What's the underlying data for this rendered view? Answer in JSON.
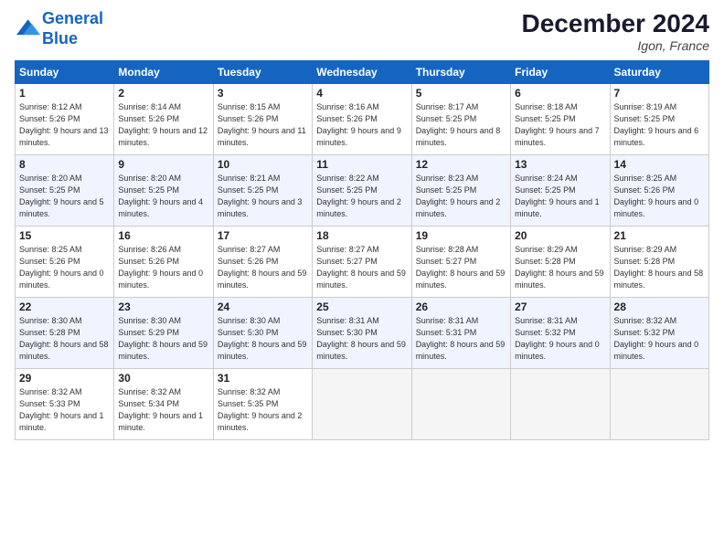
{
  "header": {
    "logo_line1": "General",
    "logo_line2": "Blue",
    "month": "December 2024",
    "location": "Igon, France"
  },
  "days_of_week": [
    "Sunday",
    "Monday",
    "Tuesday",
    "Wednesday",
    "Thursday",
    "Friday",
    "Saturday"
  ],
  "weeks": [
    [
      {
        "day": "1",
        "info": "Sunrise: 8:12 AM\nSunset: 5:26 PM\nDaylight: 9 hours and 13 minutes."
      },
      {
        "day": "2",
        "info": "Sunrise: 8:14 AM\nSunset: 5:26 PM\nDaylight: 9 hours and 12 minutes."
      },
      {
        "day": "3",
        "info": "Sunrise: 8:15 AM\nSunset: 5:26 PM\nDaylight: 9 hours and 11 minutes."
      },
      {
        "day": "4",
        "info": "Sunrise: 8:16 AM\nSunset: 5:26 PM\nDaylight: 9 hours and 9 minutes."
      },
      {
        "day": "5",
        "info": "Sunrise: 8:17 AM\nSunset: 5:25 PM\nDaylight: 9 hours and 8 minutes."
      },
      {
        "day": "6",
        "info": "Sunrise: 8:18 AM\nSunset: 5:25 PM\nDaylight: 9 hours and 7 minutes."
      },
      {
        "day": "7",
        "info": "Sunrise: 8:19 AM\nSunset: 5:25 PM\nDaylight: 9 hours and 6 minutes."
      }
    ],
    [
      {
        "day": "8",
        "info": "Sunrise: 8:20 AM\nSunset: 5:25 PM\nDaylight: 9 hours and 5 minutes."
      },
      {
        "day": "9",
        "info": "Sunrise: 8:20 AM\nSunset: 5:25 PM\nDaylight: 9 hours and 4 minutes."
      },
      {
        "day": "10",
        "info": "Sunrise: 8:21 AM\nSunset: 5:25 PM\nDaylight: 9 hours and 3 minutes."
      },
      {
        "day": "11",
        "info": "Sunrise: 8:22 AM\nSunset: 5:25 PM\nDaylight: 9 hours and 2 minutes."
      },
      {
        "day": "12",
        "info": "Sunrise: 8:23 AM\nSunset: 5:25 PM\nDaylight: 9 hours and 2 minutes."
      },
      {
        "day": "13",
        "info": "Sunrise: 8:24 AM\nSunset: 5:25 PM\nDaylight: 9 hours and 1 minute."
      },
      {
        "day": "14",
        "info": "Sunrise: 8:25 AM\nSunset: 5:26 PM\nDaylight: 9 hours and 0 minutes."
      }
    ],
    [
      {
        "day": "15",
        "info": "Sunrise: 8:25 AM\nSunset: 5:26 PM\nDaylight: 9 hours and 0 minutes."
      },
      {
        "day": "16",
        "info": "Sunrise: 8:26 AM\nSunset: 5:26 PM\nDaylight: 9 hours and 0 minutes."
      },
      {
        "day": "17",
        "info": "Sunrise: 8:27 AM\nSunset: 5:26 PM\nDaylight: 8 hours and 59 minutes."
      },
      {
        "day": "18",
        "info": "Sunrise: 8:27 AM\nSunset: 5:27 PM\nDaylight: 8 hours and 59 minutes."
      },
      {
        "day": "19",
        "info": "Sunrise: 8:28 AM\nSunset: 5:27 PM\nDaylight: 8 hours and 59 minutes."
      },
      {
        "day": "20",
        "info": "Sunrise: 8:29 AM\nSunset: 5:28 PM\nDaylight: 8 hours and 59 minutes."
      },
      {
        "day": "21",
        "info": "Sunrise: 8:29 AM\nSunset: 5:28 PM\nDaylight: 8 hours and 58 minutes."
      }
    ],
    [
      {
        "day": "22",
        "info": "Sunrise: 8:30 AM\nSunset: 5:28 PM\nDaylight: 8 hours and 58 minutes."
      },
      {
        "day": "23",
        "info": "Sunrise: 8:30 AM\nSunset: 5:29 PM\nDaylight: 8 hours and 59 minutes."
      },
      {
        "day": "24",
        "info": "Sunrise: 8:30 AM\nSunset: 5:30 PM\nDaylight: 8 hours and 59 minutes."
      },
      {
        "day": "25",
        "info": "Sunrise: 8:31 AM\nSunset: 5:30 PM\nDaylight: 8 hours and 59 minutes."
      },
      {
        "day": "26",
        "info": "Sunrise: 8:31 AM\nSunset: 5:31 PM\nDaylight: 8 hours and 59 minutes."
      },
      {
        "day": "27",
        "info": "Sunrise: 8:31 AM\nSunset: 5:32 PM\nDaylight: 9 hours and 0 minutes."
      },
      {
        "day": "28",
        "info": "Sunrise: 8:32 AM\nSunset: 5:32 PM\nDaylight: 9 hours and 0 minutes."
      }
    ],
    [
      {
        "day": "29",
        "info": "Sunrise: 8:32 AM\nSunset: 5:33 PM\nDaylight: 9 hours and 1 minute."
      },
      {
        "day": "30",
        "info": "Sunrise: 8:32 AM\nSunset: 5:34 PM\nDaylight: 9 hours and 1 minute."
      },
      {
        "day": "31",
        "info": "Sunrise: 8:32 AM\nSunset: 5:35 PM\nDaylight: 9 hours and 2 minutes."
      },
      null,
      null,
      null,
      null
    ]
  ]
}
